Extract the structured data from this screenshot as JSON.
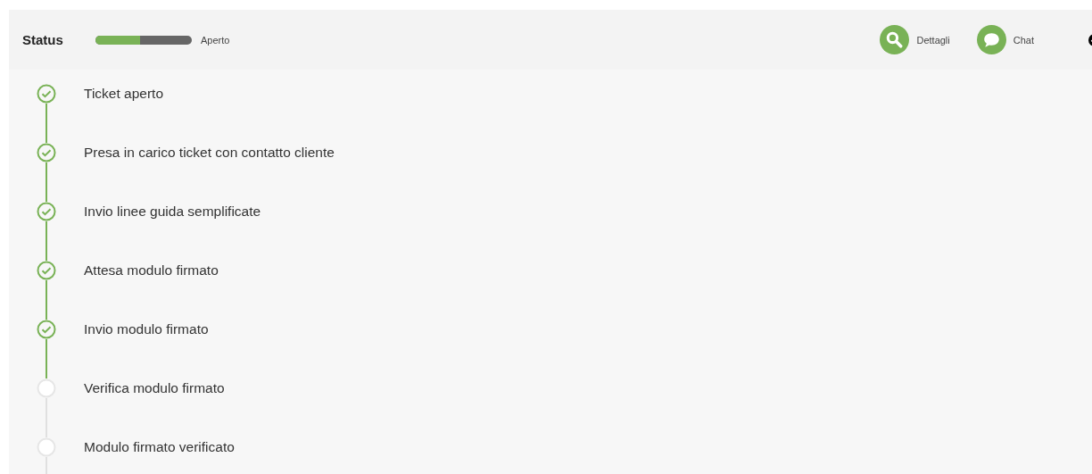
{
  "header": {
    "title": "Status",
    "progress": {
      "level": 0.46,
      "label": "Aperto"
    },
    "actions": [
      {
        "kind": "search",
        "label": "Dettagli"
      },
      {
        "kind": "chat",
        "label": "Chat"
      }
    ]
  },
  "steps": [
    {
      "label": "Ticket aperto",
      "done": true
    },
    {
      "label": "Presa in carico ticket con contatto cliente",
      "done": true
    },
    {
      "label": "Invio linee guida semplificate",
      "done": true
    },
    {
      "label": "Attesa modulo firmato",
      "done": true
    },
    {
      "label": "Invio modulo firmato",
      "done": true
    },
    {
      "label": "Verifica modulo firmato",
      "done": false
    },
    {
      "label": "Modulo firmato verificato",
      "done": false
    }
  ]
}
